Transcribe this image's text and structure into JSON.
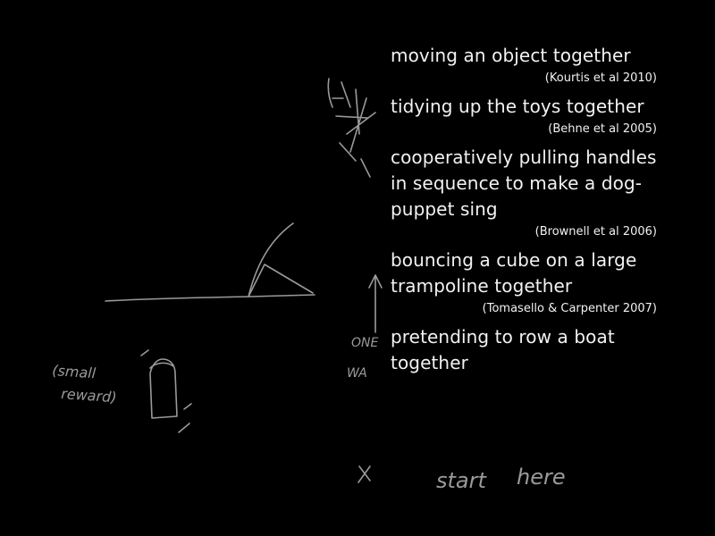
{
  "theme": {
    "background": "#000000",
    "text_color": "#f2f2f2",
    "sketch_color": "#9a9a9a"
  },
  "examples": [
    {
      "text": "moving an object together",
      "ref": "(Kourtis et al 2010)"
    },
    {
      "text": "tidying up the toys together",
      "ref": "(Behne et al 2005)"
    },
    {
      "text": "cooperatively pulling handles in sequence to make a dog-puppet sing",
      "ref": "(Brownell et al 2006)"
    },
    {
      "text": "bouncing a cube on a large trampoline together",
      "ref": "(Tomasello & Carpenter 2007)"
    },
    {
      "text": "pretending to row a boat together",
      "ref": ""
    }
  ],
  "sketch": {
    "label_small": "(small",
    "label_reward": "reward)",
    "label_one": "ONE",
    "label_way": "WA",
    "label_x": "x",
    "label_start": "start",
    "label_here": "here"
  }
}
